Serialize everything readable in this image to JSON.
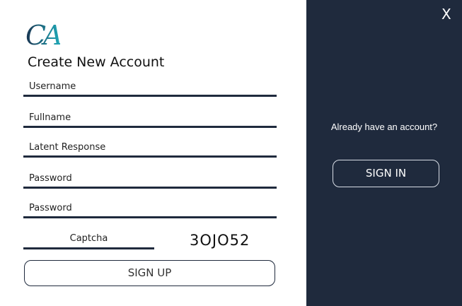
{
  "logo": {
    "text": "CA"
  },
  "form": {
    "title": "Create New Account",
    "fields": [
      {
        "placeholder": "Username"
      },
      {
        "placeholder": "Fullname"
      },
      {
        "placeholder": "Latent Response"
      },
      {
        "placeholder": "Password"
      },
      {
        "placeholder": "Password"
      }
    ],
    "captcha": {
      "placeholder": "Captcha",
      "code": "3OJO52"
    },
    "signup_label": "SIGN UP"
  },
  "side_panel": {
    "close_label": "X",
    "prompt": "Already have an account?",
    "signin_label": "SIGN IN"
  },
  "colors": {
    "panel": "#1f2a3d",
    "accent": "#1fa9b8"
  }
}
